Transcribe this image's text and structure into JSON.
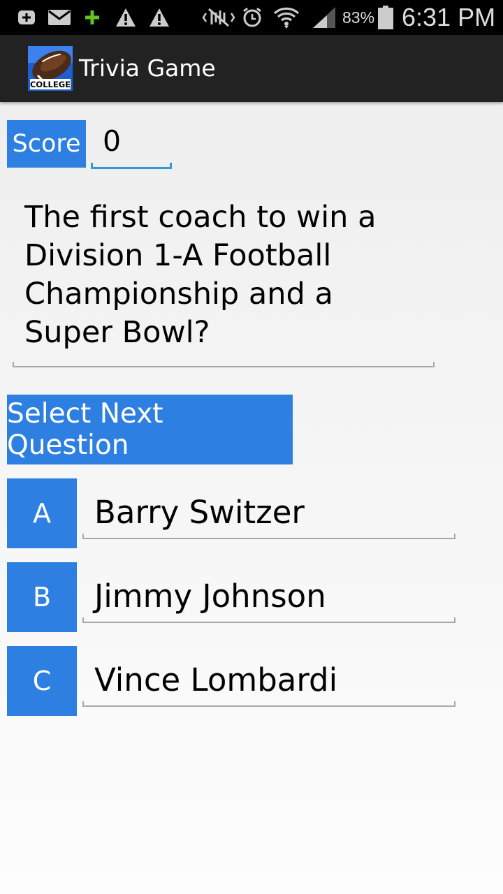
{
  "status_bar": {
    "battery": "83%",
    "time": "6:31 PM",
    "icons": [
      "add-icon",
      "mail-icon",
      "plus-icon",
      "warning-icon",
      "warning-icon",
      "mute-icon",
      "alarm-icon",
      "wifi-icon",
      "signal-icon",
      "battery-icon"
    ]
  },
  "app": {
    "title": "Trivia Game",
    "logo_text": "COLLEGE"
  },
  "score": {
    "label": "Score",
    "value": "0"
  },
  "question": {
    "text": "The first coach to win a Division 1-A Football Championship and a Super Bowl?"
  },
  "next_button": {
    "label": "Select Next Question"
  },
  "answers": [
    {
      "letter": "A",
      "text": "Barry Switzer"
    },
    {
      "letter": "B",
      "text": "Jimmy Johnson"
    },
    {
      "letter": "C",
      "text": "Vince Lombardi"
    }
  ],
  "colors": {
    "accent": "#2d7fe1",
    "field_underline": "#2e9bd6",
    "action_bar": "#222222"
  }
}
